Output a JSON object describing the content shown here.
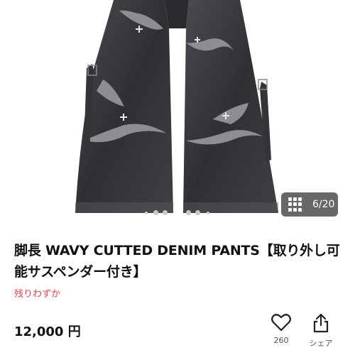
{
  "gallery": {
    "counter": "6/20",
    "grid_icon": "grid-icon",
    "page_dots": 5,
    "active_dot": 2
  },
  "product": {
    "title": "脚長 WAVY CUTTED DENIM PANTS【取り外し可能サスペンダー付き】",
    "stock_note": "残りわずか",
    "price": "12,000 円"
  },
  "actions": {
    "like_count": "260",
    "like_icon": "heart-icon",
    "share_label": "シェア",
    "share_icon": "share-icon"
  },
  "colors": {
    "stock_red": "#e0434f",
    "denim_dark": "#3a3b3f"
  }
}
